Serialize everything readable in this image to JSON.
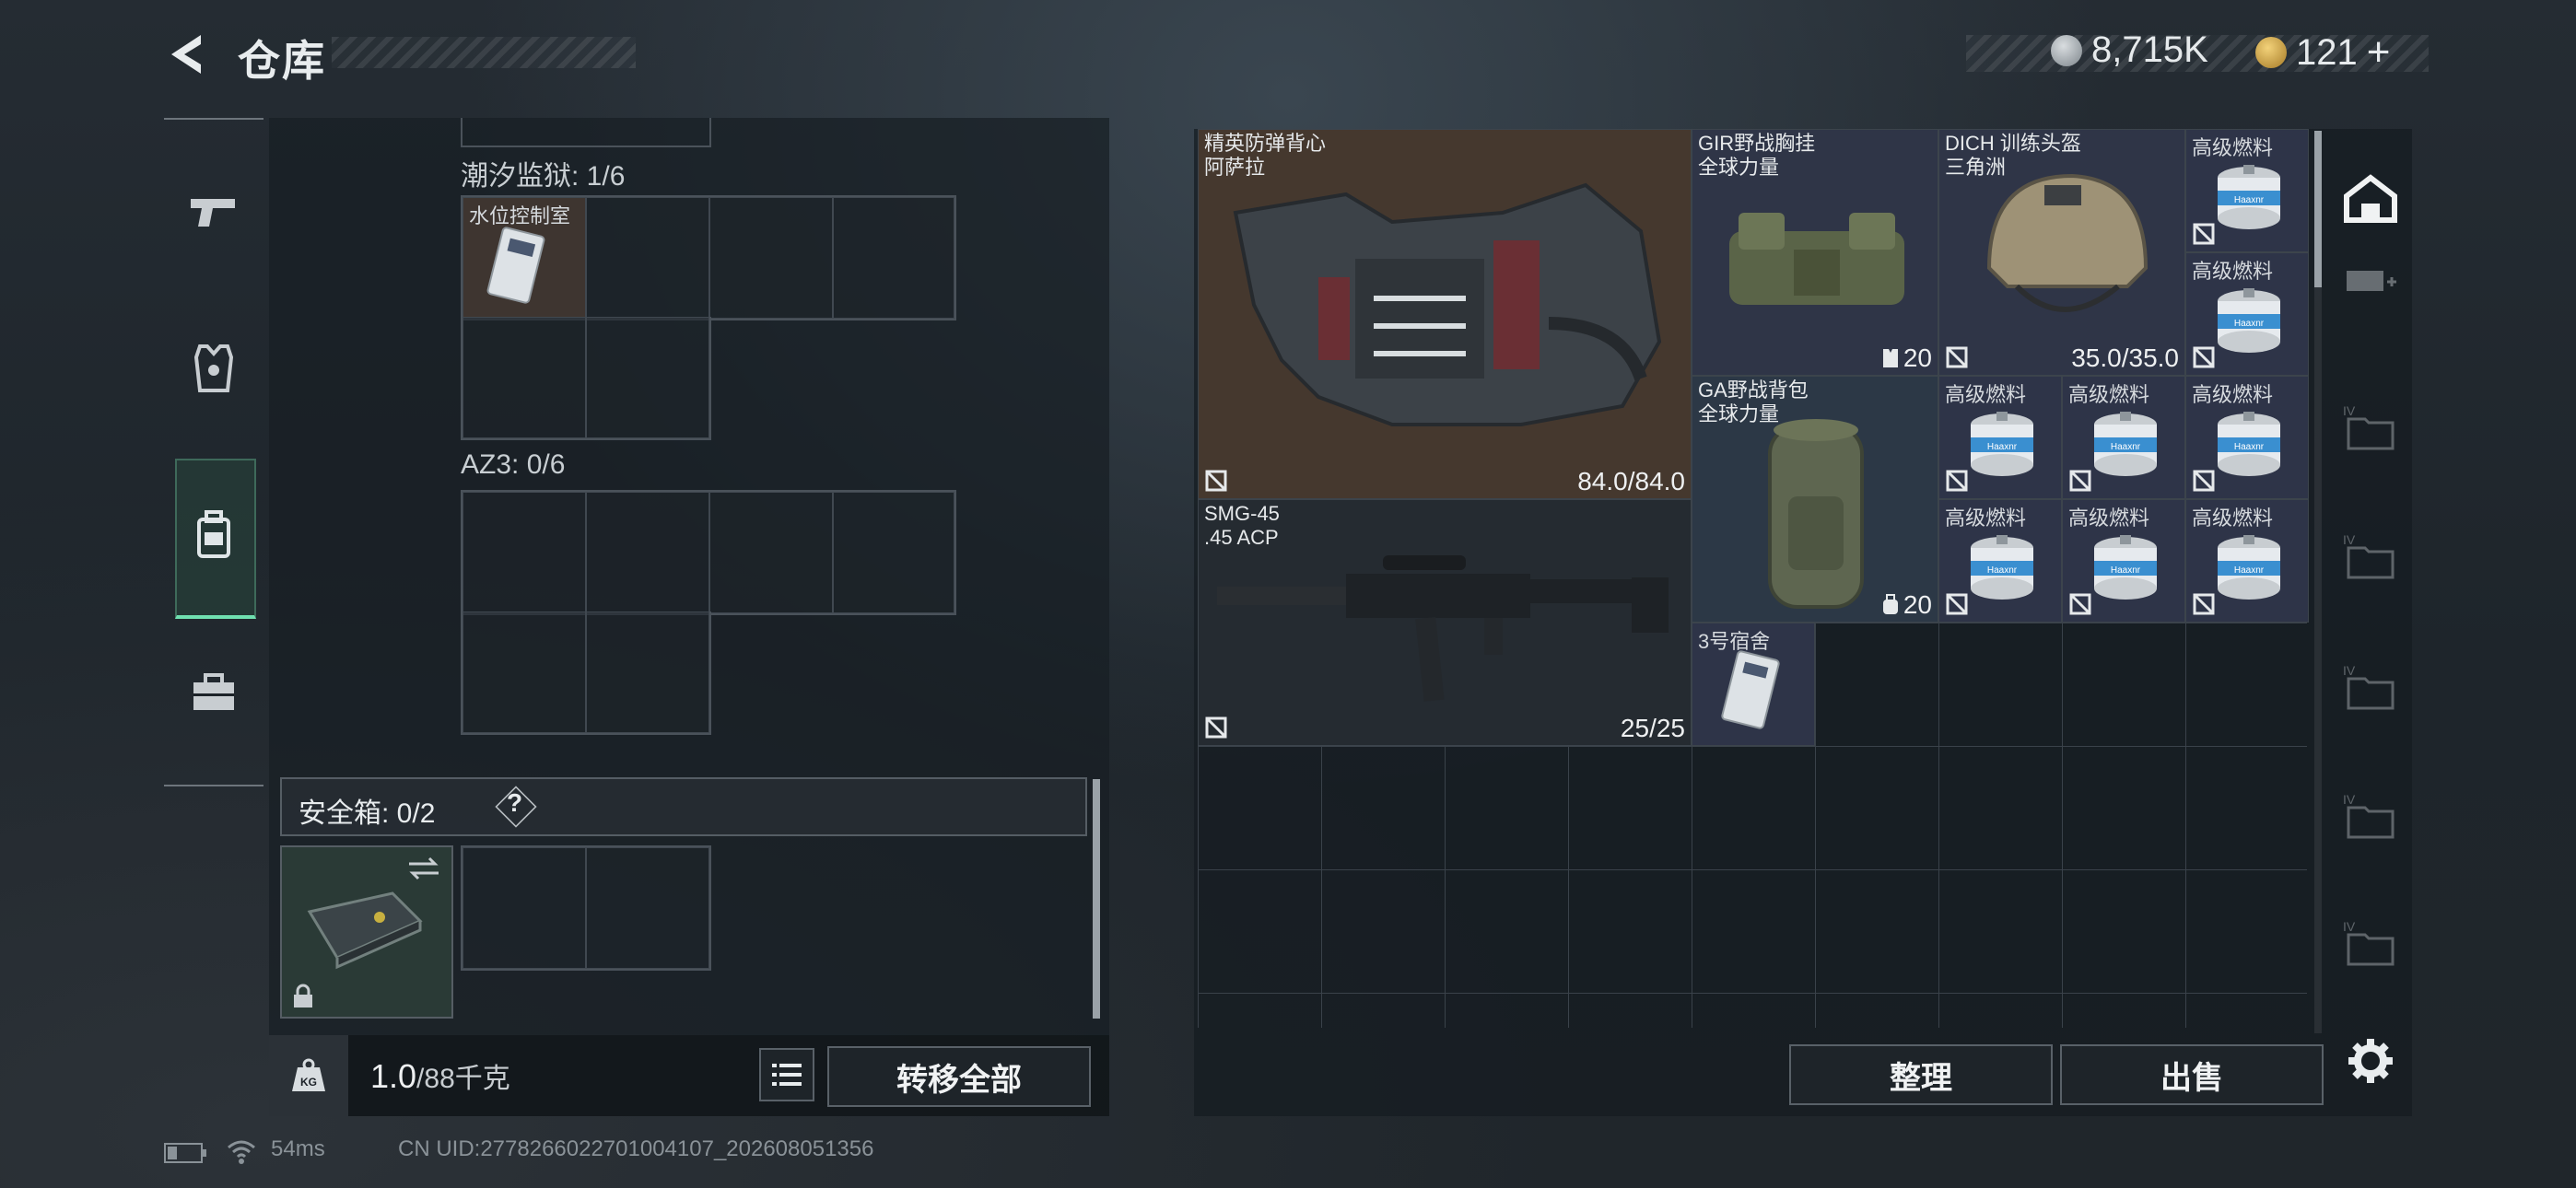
{
  "header": {
    "title": "仓库"
  },
  "currency": {
    "silver": "8,715K",
    "gold": "121",
    "gold_plus": "+"
  },
  "nav": {
    "items": [
      "weapon-tab",
      "armor-tab",
      "backpack-tab",
      "supplies-tab"
    ],
    "active": "backpack-tab"
  },
  "left": {
    "container1_label": "潮汐监狱: 1/6",
    "container1_item": "水位控制室",
    "container2_label": "AZ3: 0/6",
    "safe_label": "安全箱: 0/2",
    "safe_help": "?",
    "weight_value": "1.0",
    "weight_max": "/88千克",
    "transfer_all": "转移全部"
  },
  "items": {
    "vest_name": "精英防弹背心",
    "vest_map": "阿萨拉",
    "vest_dur": "84.0/84.0",
    "chest_name": "GIR野战胸挂",
    "chest_sub": "全球力量",
    "chest_count": "20",
    "helmet_name": "DICH 训练头盔",
    "helmet_sub": "三角洲",
    "helmet_dur": "35.0/35.0",
    "bag_name": "GA野战背包",
    "bag_sub": "全球力量",
    "bag_count": "20",
    "gun_name": "SMG-45",
    "gun_ammo": ".45 ACP",
    "gun_mag": "25/25",
    "key_name": "3号宿舍",
    "fuel_name": "高级燃料",
    "fuel_brand": "Haaxnr"
  },
  "actions": {
    "sort": "整理",
    "sell": "出售"
  },
  "status": {
    "ping": "54ms",
    "uid": "CN UID:2778266022701004107_202608051356"
  },
  "colors": {
    "accent": "#6fe0b0",
    "item_bg_orange": "#4a3a2e",
    "item_bg_blue": "#2e3448"
  }
}
